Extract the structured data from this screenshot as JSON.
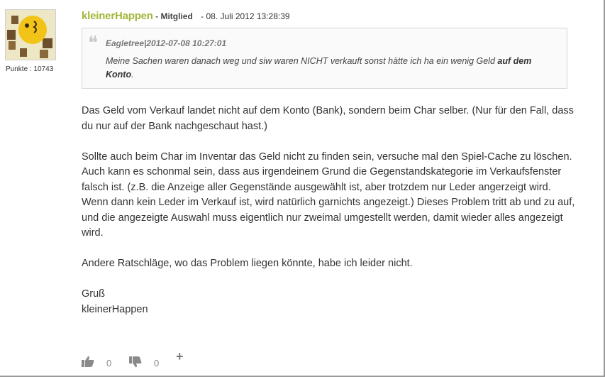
{
  "post": {
    "author": "kleinerHappen",
    "separator": "-",
    "rank": "Mitglied",
    "date": "- 08. Juli 2012 13:28:39",
    "points": "Punkte : 10743"
  },
  "quote": {
    "author": "Eagletree|2012-07-08 10:27:01",
    "text_before": "Meine Sachen waren danach weg und siw waren NICHT verkauft sonst hätte ich ha ein wenig Geld ",
    "text_bold": "auf dem Konto",
    "text_after": "."
  },
  "body": {
    "p1": "Das Geld vom Verkauf landet nicht auf dem Konto (Bank), sondern beim Char selber. (Nur für den Fall, dass du nur auf der Bank nachgeschaut hast.)",
    "p2": "Sollte auch beim Char im Inventar das Geld nicht zu finden sein, versuche mal den Spiel-Cache zu löschen. Auch kann es schonmal sein, dass aus irgendeinem Grund die Gegenstandskategorie im Verkaufsfenster falsch ist. (z.B. die Anzeige aller Gegenstände ausgewählt ist, aber trotzdem nur Leder angerzeigt wird. Wenn dann kein Leder im Verkauf ist, wird natürlich garnichts angezeigt.) Dieses Problem tritt ab und zu auf, und die angezeigte Auswahl muss eigentlich nur zweimal umgestellt werden, damit wieder alles angezeigt wird.",
    "p3": "Andere Ratschläge, wo das Problem liegen könnte, habe ich leider nicht.",
    "greeting": "Gruß",
    "signature": "kleinerHappen"
  },
  "votes": {
    "likes": "0",
    "dislikes": "0",
    "add_label": "+"
  },
  "colors": {
    "username": "#a2b63a",
    "quote_bg": "#fafafa",
    "quote_border": "#d6d6d6"
  }
}
